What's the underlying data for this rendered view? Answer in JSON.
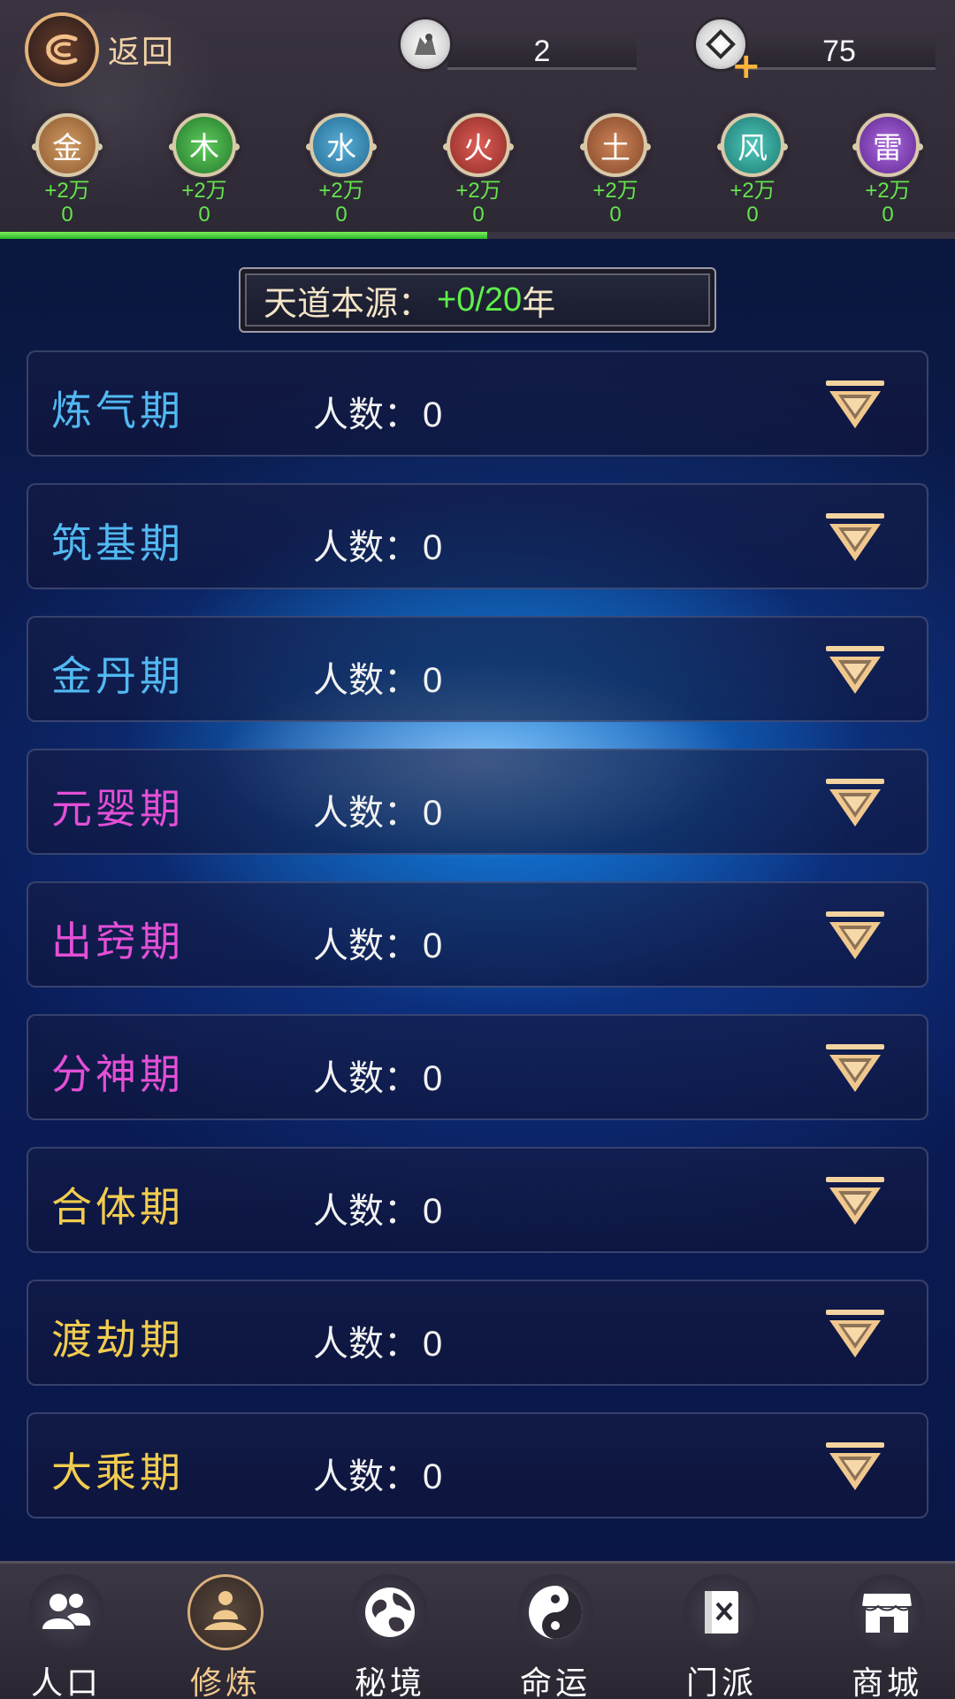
{
  "header": {
    "back_label": "返回",
    "resource_1": {
      "icon": "spirit-beast-icon",
      "value": "2"
    },
    "resource_2": {
      "icon": "spirit-stone-coin-icon",
      "value": "75"
    }
  },
  "elements": [
    {
      "symbol": "金",
      "gain": "+2万",
      "count": "0",
      "color": "#b8834e"
    },
    {
      "symbol": "木",
      "gain": "+2万",
      "count": "0",
      "color": "#3fa54a"
    },
    {
      "symbol": "水",
      "gain": "+2万",
      "count": "0",
      "color": "#3d8fb8"
    },
    {
      "symbol": "火",
      "gain": "+2万",
      "count": "0",
      "color": "#c0453e"
    },
    {
      "symbol": "土",
      "gain": "+2万",
      "count": "0",
      "color": "#b4683f"
    },
    {
      "symbol": "风",
      "gain": "+2万",
      "count": "0",
      "color": "#33a99f"
    },
    {
      "symbol": "雷",
      "gain": "+2万",
      "count": "0",
      "color": "#8d49c6"
    }
  ],
  "progress": {
    "fraction": 0.51,
    "color": "#4fd33a"
  },
  "source_banner": {
    "label": "天道本源：",
    "value": "+0/20",
    "unit": "年"
  },
  "realms": [
    {
      "name": "炼气期",
      "count_label": "人数：",
      "count": "0",
      "color": "#52b9f2"
    },
    {
      "name": "筑基期",
      "count_label": "人数：",
      "count": "0",
      "color": "#52b9f2"
    },
    {
      "name": "金丹期",
      "count_label": "人数：",
      "count": "0",
      "color": "#52b9f2"
    },
    {
      "name": "元婴期",
      "count_label": "人数：",
      "count": "0",
      "color": "#e34fd6"
    },
    {
      "name": "出窍期",
      "count_label": "人数：",
      "count": "0",
      "color": "#e34fd6"
    },
    {
      "name": "分神期",
      "count_label": "人数：",
      "count": "0",
      "color": "#e34fd6"
    },
    {
      "name": "合体期",
      "count_label": "人数：",
      "count": "0",
      "color": "#f1cc4f"
    },
    {
      "name": "渡劫期",
      "count_label": "人数：",
      "count": "0",
      "color": "#f1cc4f"
    },
    {
      "name": "大乘期",
      "count_label": "人数：",
      "count": "0",
      "color": "#f1cc4f"
    }
  ],
  "bottom_nav": [
    {
      "label": "人口",
      "icon": "people-icon",
      "active": false
    },
    {
      "label": "修炼",
      "icon": "meditation-icon",
      "active": true
    },
    {
      "label": "秘境",
      "icon": "globe-icon",
      "active": false
    },
    {
      "label": "命运",
      "icon": "yin-yang-icon",
      "active": false
    },
    {
      "label": "门派",
      "icon": "sect-scroll-icon",
      "active": false
    },
    {
      "label": "商城",
      "icon": "shop-icon",
      "active": false
    }
  ]
}
